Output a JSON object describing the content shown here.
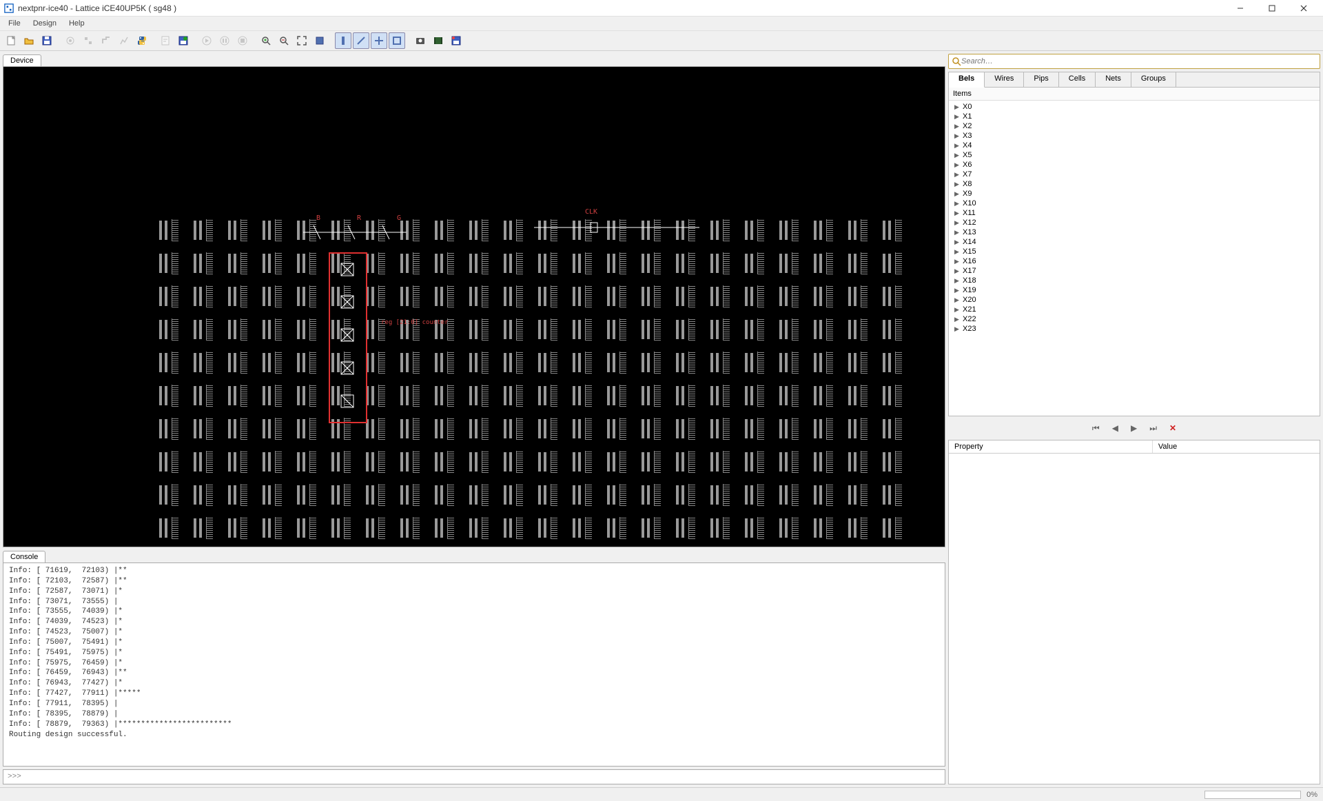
{
  "window": {
    "title": "nextpnr-ice40 - Lattice iCE40UP5K ( sg48 )"
  },
  "menu": [
    "File",
    "Design",
    "Help"
  ],
  "panels": {
    "device": "Device",
    "console": "Console",
    "items": "Items"
  },
  "search": {
    "placeholder": "Search…"
  },
  "tabs": [
    "Bels",
    "Wires",
    "Pips",
    "Cells",
    "Nets",
    "Groups"
  ],
  "tree_items": [
    "X0",
    "X1",
    "X2",
    "X3",
    "X4",
    "X5",
    "X6",
    "X7",
    "X8",
    "X9",
    "X10",
    "X11",
    "X12",
    "X13",
    "X14",
    "X15",
    "X16",
    "X17",
    "X18",
    "X19",
    "X20",
    "X21",
    "X22",
    "X23"
  ],
  "props": {
    "col1": "Property",
    "col2": "Value"
  },
  "device_labels": {
    "b": "B",
    "r": "R",
    "g": "G",
    "clk": "CLK",
    "reg": "reg [21:0] counter"
  },
  "console_lines": [
    "Info: [ 71619,  72103) |**",
    "Info: [ 72103,  72587) |**",
    "Info: [ 72587,  73071) |*",
    "Info: [ 73071,  73555) |",
    "Info: [ 73555,  74039) |*",
    "Info: [ 74039,  74523) |*",
    "Info: [ 74523,  75007) |*",
    "Info: [ 75007,  75491) |*",
    "Info: [ 75491,  75975) |*",
    "Info: [ 75975,  76459) |*",
    "Info: [ 76459,  76943) |**",
    "Info: [ 76943,  77427) |*",
    "Info: [ 77427,  77911) |*****",
    "Info: [ 77911,  78395) |",
    "Info: [ 78395,  78879) |",
    "Info: [ 78879,  79363) |*************************",
    "Routing design successful."
  ],
  "console_prompt": ">>>",
  "status": {
    "percent": "0%"
  }
}
